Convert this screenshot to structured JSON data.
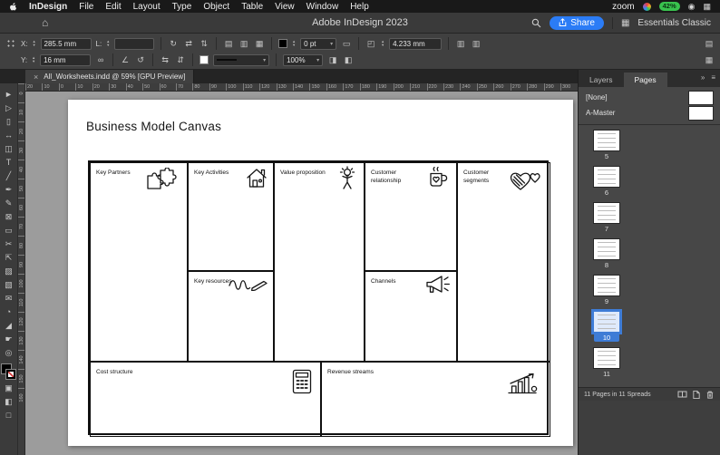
{
  "menu_bar": {
    "app_name": "InDesign",
    "menus": [
      "File",
      "Edit",
      "Layout",
      "Type",
      "Object",
      "Table",
      "View",
      "Window",
      "Help"
    ],
    "zoom_label": "zoom",
    "battery": "42%"
  },
  "title_bar": {
    "title": "Adobe InDesign 2023",
    "share_label": "Share",
    "workspace": "Essentials Classic"
  },
  "control_panel": {
    "x_label": "X:",
    "x_value": "285.5 mm",
    "y_label": "Y:",
    "y_value": "16 mm",
    "l_label": "L:",
    "l_value": "",
    "stroke_weight": "0 pt",
    "corner_radius": "4.233 mm",
    "zoom_level": "100%"
  },
  "document_tab": {
    "close_label": "×",
    "label": "All_Worksheets.indd @ 59% [GPU Preview]"
  },
  "rulers": {
    "horizontal": [
      "20",
      "10",
      "0",
      "10",
      "20",
      "30",
      "40",
      "50",
      "60",
      "70",
      "80",
      "90",
      "100",
      "110",
      "120",
      "130",
      "140",
      "150",
      "160",
      "170",
      "180",
      "190",
      "200",
      "210",
      "220",
      "230",
      "240",
      "250",
      "260",
      "270",
      "280",
      "290",
      "300"
    ],
    "vertical": [
      "0",
      "10",
      "20",
      "30",
      "40",
      "50",
      "60",
      "70",
      "80",
      "90",
      "100",
      "110",
      "120",
      "130",
      "140",
      "150",
      "160"
    ]
  },
  "toolbar": {
    "tools": [
      {
        "name": "selection-tool",
        "glyph": "►"
      },
      {
        "name": "direct-selection-tool",
        "glyph": "▷"
      },
      {
        "name": "page-tool",
        "glyph": "▯"
      },
      {
        "name": "gap-tool",
        "glyph": "↔"
      },
      {
        "name": "content-collector-tool",
        "glyph": "◫"
      },
      {
        "name": "type-tool",
        "glyph": "T"
      },
      {
        "name": "line-tool",
        "glyph": "╱"
      },
      {
        "name": "pen-tool",
        "glyph": "✒"
      },
      {
        "name": "pencil-tool",
        "glyph": "✎"
      },
      {
        "name": "rectangle-frame-tool",
        "glyph": "⊠"
      },
      {
        "name": "rectangle-tool",
        "glyph": "▭"
      },
      {
        "name": "scissors-tool",
        "glyph": "✂"
      },
      {
        "name": "free-transform-tool",
        "glyph": "⇱"
      },
      {
        "name": "gradient-swatch-tool",
        "glyph": "▨"
      },
      {
        "name": "gradient-feather-tool",
        "glyph": "▧"
      },
      {
        "name": "note-tool",
        "glyph": "✉"
      },
      {
        "name": "color-theme-tool",
        "glyph": "◔"
      },
      {
        "name": "eyedropper-tool",
        "glyph": "◢"
      },
      {
        "name": "hand-tool",
        "glyph": "☛"
      },
      {
        "name": "zoom-tool",
        "glyph": "◎"
      }
    ]
  },
  "canvas": {
    "title": "Business Model Canvas",
    "cells": {
      "key_partners": "Key Partners",
      "key_activities": "Key Activities",
      "value_proposition": "Value proposition",
      "customer_relationship": "Customer relationship",
      "customer_segments": "Customer segments",
      "key_resources": "Key resources",
      "channels": "Channels",
      "cost_structure": "Cost structure",
      "revenue_streams": "Revenue streams"
    }
  },
  "panels": {
    "tabs": [
      "Layers",
      "Pages"
    ],
    "pages_panel": {
      "masters": [
        "[None]",
        "A-Master"
      ],
      "pages": [
        {
          "num": "5"
        },
        {
          "num": "6"
        },
        {
          "num": "7"
        },
        {
          "num": "8"
        },
        {
          "num": "9"
        },
        {
          "num": "10",
          "selected": true
        },
        {
          "num": "11"
        }
      ],
      "status": "11 Pages in 11 Spreads"
    }
  }
}
